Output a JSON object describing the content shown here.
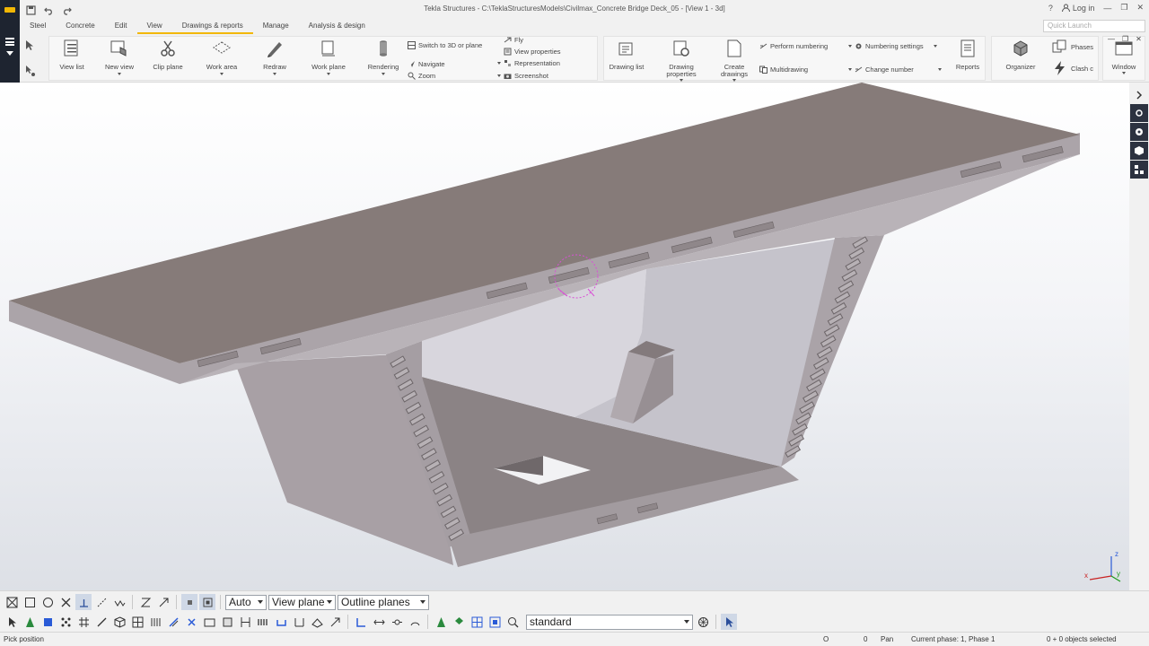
{
  "app": {
    "title": "Tekla Structures - C:\\TeklaStructuresModels\\Civilmax_Concrete Bridge Deck_05  - [View 1 - 3d]",
    "login_label": "Log in",
    "help_label": "?",
    "quick_launch_placeholder": "Quick Launch"
  },
  "menu": {
    "tabs": [
      "Steel",
      "Concrete",
      "Edit",
      "View",
      "Drawings & reports",
      "Manage",
      "Analysis & design"
    ],
    "active_tab": "View"
  },
  "ribbon": {
    "view_list": "View list",
    "new_view": "New view",
    "clip_plane": "Clip plane",
    "work_area": "Work area",
    "redraw": "Redraw",
    "work_plane": "Work plane",
    "rendering": "Rendering",
    "switch_3d": "Switch to 3D or plane",
    "navigate": "Navigate",
    "zoom": "Zoom",
    "fly": "Fly",
    "view_properties": "View properties",
    "representation": "Representation",
    "screenshot": "Screenshot",
    "drawing_list": "Drawing list",
    "drawing_properties_1": "Drawing",
    "drawing_properties_2": "properties",
    "create_drawings_1": "Create",
    "create_drawings_2": "drawings",
    "perform_numbering": "Perform numbering",
    "multidrawing": "Multidrawing",
    "numbering_settings": "Numbering settings",
    "change_number": "Change number",
    "reports": "Reports",
    "organizer": "Organizer",
    "phases": "Phases",
    "clash_check": "Clash c",
    "window": "Window"
  },
  "toolbar": {
    "auto_select": "Auto",
    "plane_select": "View plane",
    "outline_select": "Outline planes",
    "filter_select": "standard"
  },
  "status": {
    "prompt": "Pick position",
    "o_label": "O",
    "coord": "0",
    "mode": "Pan",
    "phase": "Current phase: 1, Phase 1",
    "selection": "0 + 0 objects selected"
  },
  "colors": {
    "accent": "#f2b705",
    "dark_panel": "#1e2430",
    "deck_top": "#867b79",
    "deck_side": "#a9a2a6",
    "deck_inner": "#c2c0c8",
    "pick_circle": "#d94fd6"
  },
  "axes": {
    "x_label": "x",
    "y_label": "y",
    "z_label": "z"
  }
}
